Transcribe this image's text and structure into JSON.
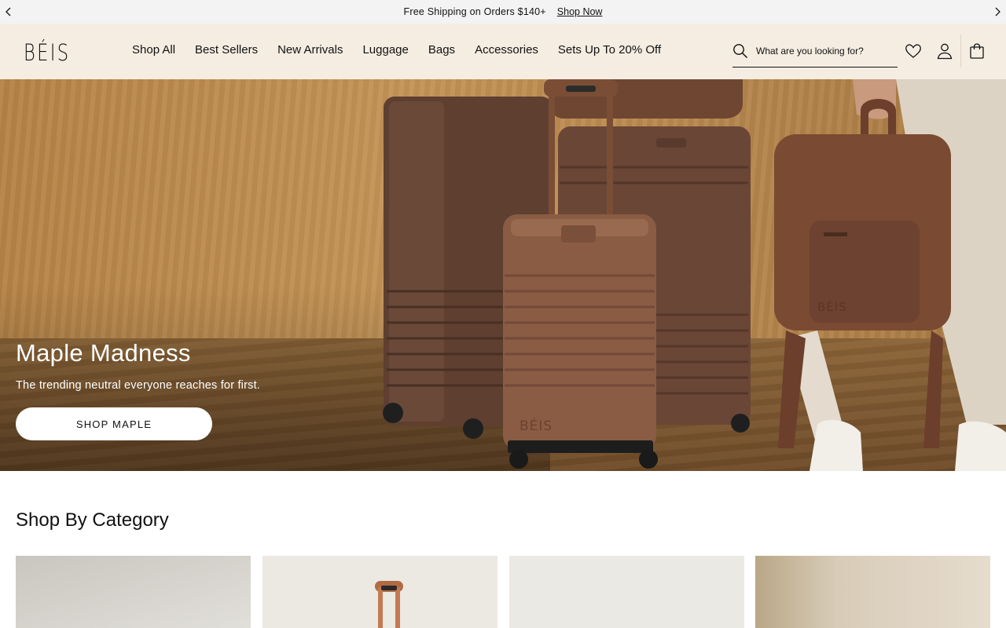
{
  "announcement": {
    "message": "Free Shipping on Orders $140+",
    "link_label": "Shop Now"
  },
  "header": {
    "logo": "BÉIS",
    "nav": [
      {
        "label": "Shop All"
      },
      {
        "label": "Best Sellers"
      },
      {
        "label": "New Arrivals"
      },
      {
        "label": "Luggage"
      },
      {
        "label": "Bags"
      },
      {
        "label": "Accessories"
      },
      {
        "label": "Sets Up To 20% Off"
      }
    ],
    "search": {
      "placeholder": "What are you looking for?",
      "icon": "search-icon"
    },
    "icons": [
      "heart-icon",
      "account-icon",
      "cart-icon"
    ]
  },
  "hero": {
    "title": "Maple Madness",
    "subtitle": "The trending neutral everyone reaches for first.",
    "button_label": "SHOP MAPLE",
    "luggage_brand_mark": "BÉIS"
  },
  "category": {
    "title": "Shop By Category",
    "cards": [
      {
        "name": "category-card-1",
        "bg": "#d9d7d1"
      },
      {
        "name": "category-card-2",
        "bg": "#ebe7e1"
      },
      {
        "name": "category-card-3",
        "bg": "#eceae5"
      },
      {
        "name": "category-card-4",
        "bg": "#d6c9b4"
      }
    ]
  },
  "colors": {
    "announce_bg": "#f3f3f3",
    "header_bg": "#f6ede2",
    "maple_brown": "#7a4e35"
  }
}
